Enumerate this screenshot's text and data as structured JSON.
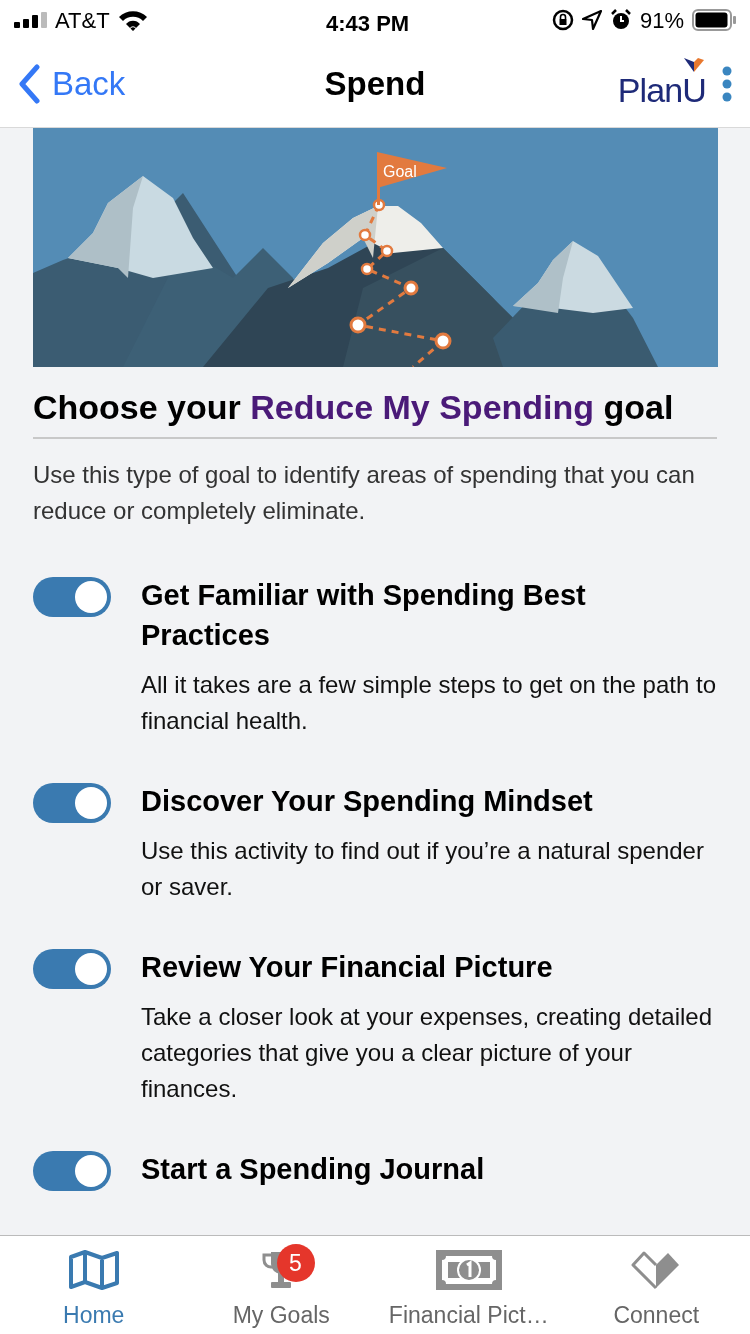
{
  "status_bar": {
    "carrier": "AT&T",
    "time": "4:43 PM",
    "battery": "91%"
  },
  "nav": {
    "back": "Back",
    "title": "Spend",
    "logo": "PlanU"
  },
  "banner": {
    "flag": "Goal"
  },
  "heading": {
    "before": "Choose your ",
    "highlight": "Reduce My Spending",
    "after": " goal"
  },
  "description": "Use this type of goal to identify areas of spending that you can reduce or completely eliminate.",
  "activities": [
    {
      "title": "Get Familiar with Spending Best Practices",
      "text": "All it takes are a few simple steps to get on the path to financial health.",
      "on": true
    },
    {
      "title": "Discover Your Spending Mindset",
      "text": "Use this activity to find out if you’re a natural spender or saver.",
      "on": true
    },
    {
      "title": "Review Your Financial Picture",
      "text": "Take a closer look at your expenses, creating detailed categories that give you a clear picture of your finances.",
      "on": true
    },
    {
      "title": "Start a Spending Journal",
      "on": true
    }
  ],
  "tab_bar": [
    {
      "kind": "map",
      "label": "Home",
      "selected": true
    },
    {
      "kind": "trophy",
      "label": "My Goals",
      "selected": false,
      "badge": "5"
    },
    {
      "kind": "bill",
      "label": "Financial Pict…",
      "selected": false
    },
    {
      "kind": "heart",
      "label": "Connect",
      "selected": false
    }
  ]
}
